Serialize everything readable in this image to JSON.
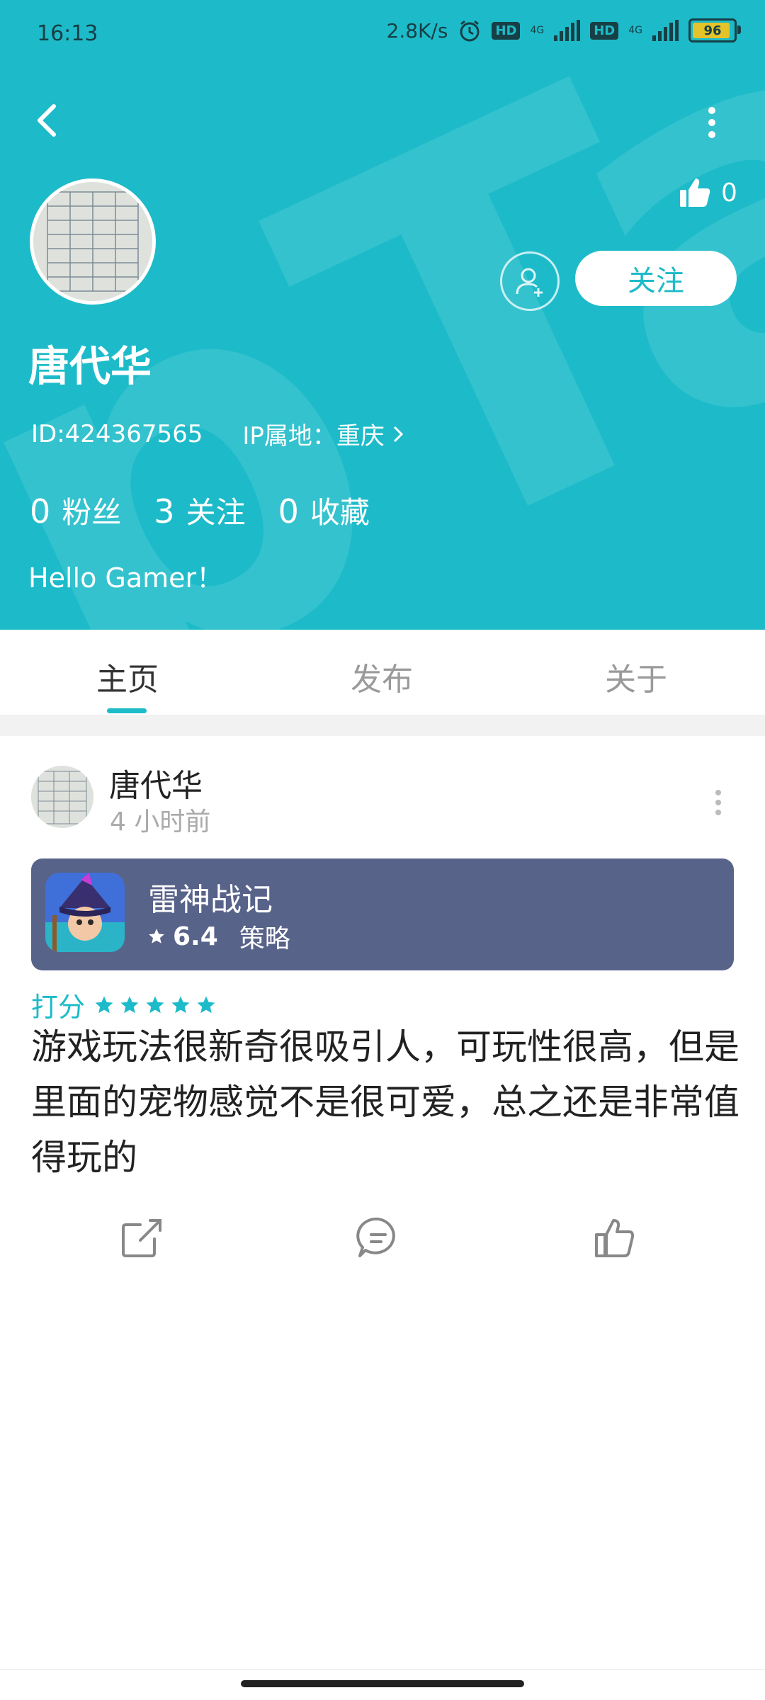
{
  "status_bar": {
    "time": "16:13",
    "network_speed": "2.8K/s",
    "hd1": "HD",
    "hd2": "HD",
    "net1": "4G",
    "net2": "4G",
    "battery": "96"
  },
  "colors": {
    "accent": "#1dbbc9",
    "game_card_bg": "#58638a",
    "star": "#1dbbc9"
  },
  "profile": {
    "likes": "0",
    "follow_label": "关注",
    "name": "唐代华",
    "id": "ID:424367565",
    "ip": "IP属地：重庆",
    "stats": [
      {
        "num": "0",
        "label": "粉丝"
      },
      {
        "num": "3",
        "label": "关注"
      },
      {
        "num": "0",
        "label": "收藏"
      }
    ],
    "bio": "Hello Gamer！"
  },
  "tabs": [
    {
      "label": "主页",
      "active": true
    },
    {
      "label": "发布",
      "active": false
    },
    {
      "label": "关于",
      "active": false
    }
  ],
  "post": {
    "author": "唐代华",
    "time": "4 小时前",
    "game": {
      "name": "雷神战记",
      "score": "6.4",
      "genre": "策略"
    },
    "rating_label": "打分",
    "rating_stars": 5,
    "review": "游戏玩法很新奇很吸引人，可玩性很高，但是里面的宠物感觉不是很可爱，总之还是非常值得玩的"
  },
  "icons": [
    "back-icon",
    "more-icon",
    "thumb-up-icon",
    "add-friend-icon",
    "chevron-right-icon",
    "star-icon",
    "share-icon",
    "comment-icon",
    "like-icon"
  ]
}
